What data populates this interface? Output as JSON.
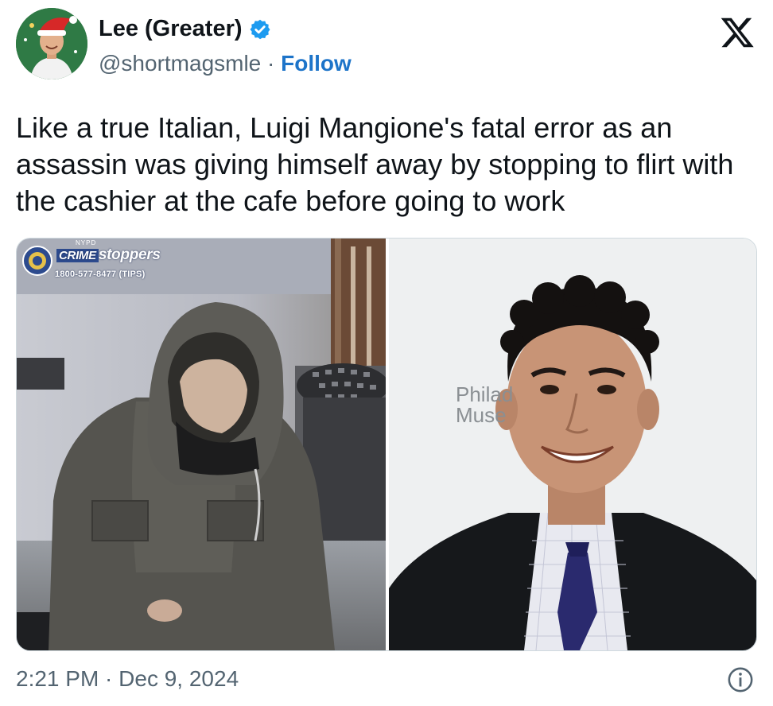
{
  "author": {
    "display_name": "Lee (Greater)",
    "handle": "@shortmagsmle",
    "separator": "·",
    "follow_label": "Follow",
    "verified_icon": "verified-badge-icon",
    "avatar_icon": "avatar-santa-hat"
  },
  "platform_icon": "x-logo-icon",
  "tweet": {
    "text": "Like a true Italian, Luigi Mangione's fatal error as an assassin was giving himself away by stopping to flirt with the cashier at the cafe before going to work"
  },
  "media": {
    "left_overlay": {
      "nypd": "NYPD",
      "crime": "CRIME",
      "stoppers": "stoppers",
      "phone": "1800-577-8477 (TIPS)"
    },
    "right_backdrop_text": {
      "line1": "Philad",
      "line2": "Muse"
    }
  },
  "footer": {
    "timestamp": "2:21 PM · Dec 9, 2024",
    "info_icon": "info-icon"
  },
  "colors": {
    "text_primary": "#0f1419",
    "text_secondary": "#536471",
    "link_blue": "#1d74c9",
    "verified_blue": "#1d9bf0",
    "border": "#cfd9de"
  }
}
